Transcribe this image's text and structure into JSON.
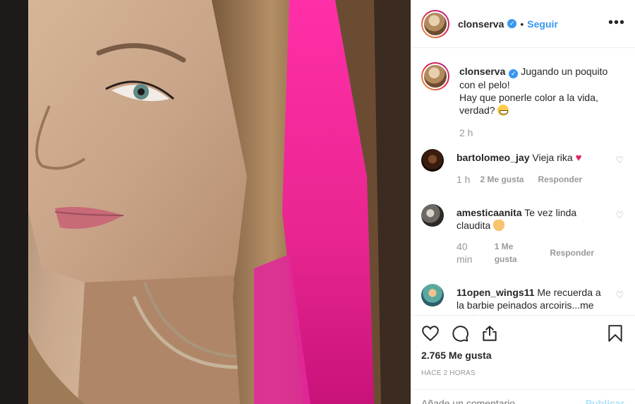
{
  "post": {
    "username": "clonserva",
    "follow_label": "Seguir",
    "more_icon": "more-options-icon",
    "caption": {
      "user": "clonserva",
      "text": "Jugando un poquito con el pelo!",
      "text2": "Hay que ponerle color a la vida, verdad?",
      "time": "2 h"
    },
    "comments": [
      {
        "user": "bartolomeo_jay",
        "text": "Vieja rika",
        "time": "1 h",
        "likes": "2 Me gusta",
        "reply": "Responder"
      },
      {
        "user": "amesticaanita",
        "text": "Te vez linda claudita",
        "time": "40 min",
        "likes": "1 Me gusta",
        "reply": "Responder"
      },
      {
        "user": "11open_wings11",
        "text": "Me recuerda a la barbie peinados arcoiris...me gusta."
      }
    ],
    "likes_count": "2.765 Me gusta",
    "time_ago": "HACE 2 HORAS",
    "add_comment_placeholder": "Añade un comentario...",
    "publish_label": "Publicar"
  },
  "colors": {
    "accent": "#3897f0",
    "muted": "#999999",
    "border": "#efefef",
    "hair_pink": "#e8258f"
  }
}
